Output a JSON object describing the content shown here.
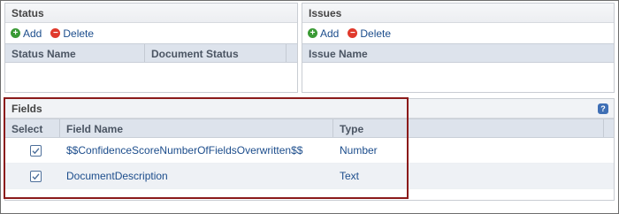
{
  "status_panel": {
    "title": "Status",
    "add_label": "Add",
    "delete_label": "Delete",
    "columns": [
      "Status Name",
      "Document Status"
    ]
  },
  "issues_panel": {
    "title": "Issues",
    "add_label": "Add",
    "delete_label": "Delete",
    "columns": [
      "Issue Name"
    ]
  },
  "fields_panel": {
    "title": "Fields",
    "columns": [
      "Select",
      "Field Name",
      "Type"
    ],
    "rows": [
      {
        "selected": true,
        "field_name": "$$ConfidenceScoreNumberOfFieldsOverwritten$$",
        "type": "Number"
      },
      {
        "selected": true,
        "field_name": "DocumentDescription",
        "type": "Text"
      }
    ]
  },
  "icons": {
    "add": "plus-circle-icon",
    "delete": "minus-circle-icon",
    "help": "help-icon",
    "checkbox": "checkmark-icon"
  },
  "colors": {
    "link": "#1c4d8c",
    "add_icon": "#3a9a35",
    "delete_icon": "#e0392c",
    "header_bg": "#dde3ec",
    "highlight_border": "#8b1a1a"
  }
}
